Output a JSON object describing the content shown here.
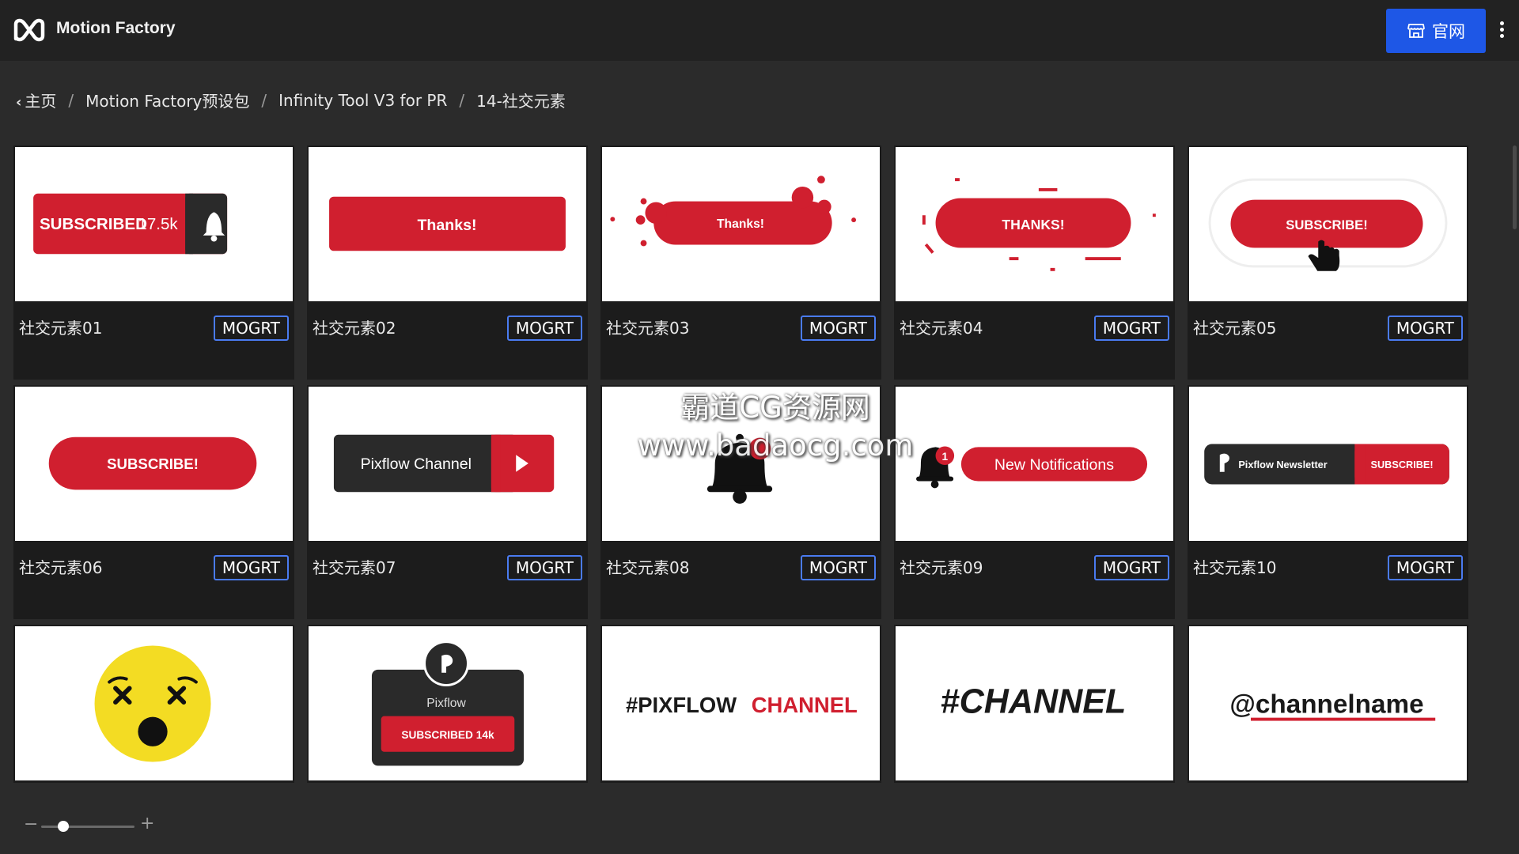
{
  "app": {
    "title": "Motion Factory",
    "logo_icon": "motion-factory-logo"
  },
  "header": {
    "site_button_label": "官网",
    "site_button_icon": "store-icon",
    "menu_icon": "kebab-menu-icon"
  },
  "breadcrumb": [
    {
      "label": "主页",
      "icon": "chevron-left-icon"
    },
    {
      "label": "Motion Factory预设包"
    },
    {
      "label": "Infinity Tool V3 for PR"
    },
    {
      "label": "14-社交元素"
    }
  ],
  "breadcrumb_separator": "/",
  "cards": [
    {
      "label": "社交元素01",
      "badge": "MOGRT",
      "preview": {
        "text": "SUBSCRIBED",
        "count": "17.5k"
      }
    },
    {
      "label": "社交元素02",
      "badge": "MOGRT",
      "preview": {
        "text": "Thanks!"
      }
    },
    {
      "label": "社交元素03",
      "badge": "MOGRT",
      "preview": {
        "text": "Thanks!"
      }
    },
    {
      "label": "社交元素04",
      "badge": "MOGRT",
      "preview": {
        "text": "THANKS!"
      }
    },
    {
      "label": "社交元素05",
      "badge": "MOGRT",
      "preview": {
        "text": "SUBSCRIBE!"
      }
    },
    {
      "label": "社交元素06",
      "badge": "MOGRT",
      "preview": {
        "text": "SUBSCRIBE!"
      }
    },
    {
      "label": "社交元素07",
      "badge": "MOGRT",
      "preview": {
        "text": "Pixflow Channel"
      }
    },
    {
      "label": "社交元素08",
      "badge": "MOGRT",
      "preview": {
        "text": ""
      }
    },
    {
      "label": "社交元素09",
      "badge": "MOGRT",
      "preview": {
        "text": "New Notifications",
        "count": "1"
      }
    },
    {
      "label": "社交元素10",
      "badge": "MOGRT",
      "preview": {
        "text": "Pixflow Newsletter",
        "action": "SUBSCRIBE!"
      }
    },
    {
      "label": "",
      "badge": "",
      "preview": {
        "text": ""
      }
    },
    {
      "label": "",
      "badge": "",
      "preview": {
        "text": "Pixflow",
        "action": "SUBSCRIBED 14k"
      }
    },
    {
      "label": "",
      "badge": "",
      "preview": {
        "text": "#PIXFLOW",
        "accent": "CHANNEL"
      }
    },
    {
      "label": "",
      "badge": "",
      "preview": {
        "text": "#CHANNEL"
      }
    },
    {
      "label": "",
      "badge": "",
      "preview": {
        "text": "@channelname"
      }
    }
  ],
  "watermark": {
    "line1": "霸道CG资源网",
    "line2": "www.badaocg.com"
  },
  "zoom": {
    "minus": "−",
    "plus": "+",
    "level": 0.2
  },
  "colors": {
    "accent_red": "#d01f2f",
    "primary_blue": "#1e57e6",
    "badge_border": "#4a7bf0",
    "dark": "#2a2a2a"
  }
}
